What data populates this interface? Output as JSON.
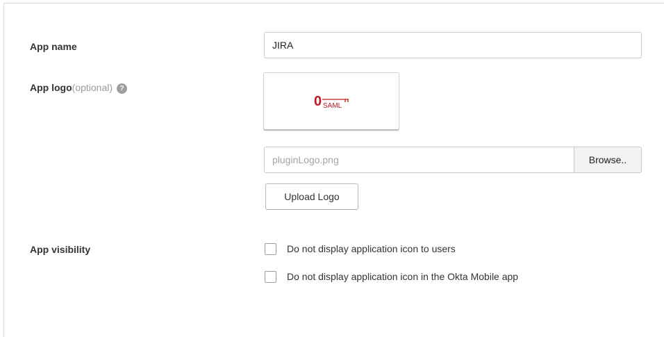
{
  "app_name": {
    "label": "App name",
    "value": "JIRA"
  },
  "app_logo": {
    "label": "App logo",
    "optional_text": "(optional)",
    "help_icon": "?",
    "logo_text_main": "0",
    "logo_text_sub": "SAML",
    "file_name": "pluginLogo.png",
    "browse_label": "Browse..",
    "upload_label": "Upload Logo"
  },
  "app_visibility": {
    "label": "App visibility",
    "options": [
      {
        "label": "Do not display application icon to users",
        "checked": false
      },
      {
        "label": "Do not display application icon in the Okta Mobile app",
        "checked": false
      }
    ]
  },
  "colors": {
    "logo_red": "#c0161e",
    "label_text": "#333333",
    "muted_text": "#9a9a9a"
  }
}
